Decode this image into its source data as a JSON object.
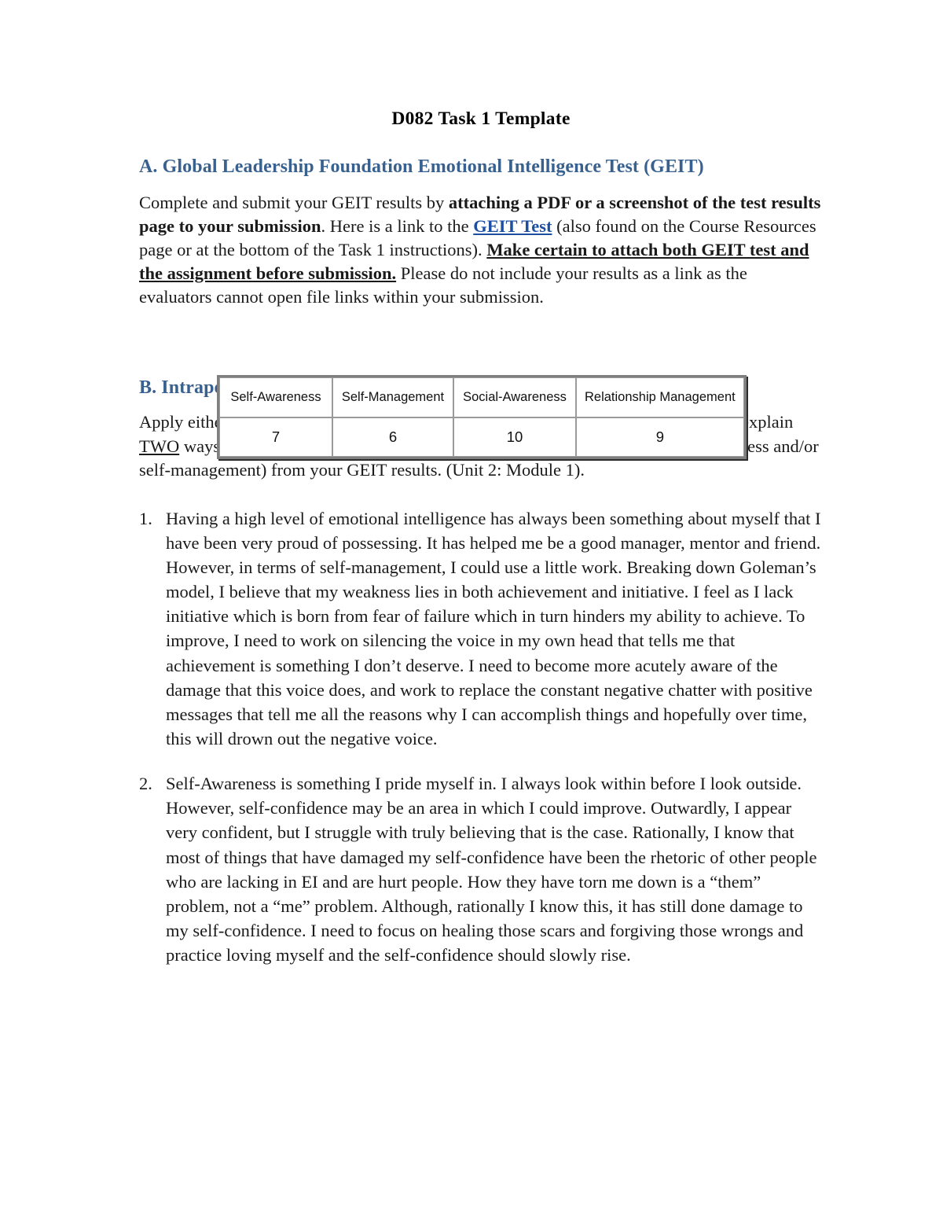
{
  "document": {
    "title": "D082 Task 1 Template",
    "accent_heading_color": "#39618f",
    "link_color": "#1d4fa0",
    "body_color": "#1a1a1a"
  },
  "section_a": {
    "heading": "A. Global Leadership Foundation Emotional Intelligence Test (GEIT)",
    "paragraph": {
      "part1": "Complete and submit your GEIT results by ",
      "bold1": "attaching a PDF or a screenshot of the test results page to your submission",
      "part2": ". Here is a link to the ",
      "link": "GEIT Test",
      "part3": " (also found on the Course Resources page or at the bottom of the Task 1 instructions). ",
      "bold_underline": "Make certain to attach both GEIT test and the assignment before submission.",
      "part4": " Please do not include your results as a link as the evaluators cannot open file links within your submission."
    }
  },
  "geit_table": {
    "headers": [
      "Self-Awareness",
      "Self-Management",
      "Social-Awareness",
      "Relationship Management"
    ],
    "values": [
      "7",
      "6",
      "10",
      "9"
    ]
  },
  "section_b": {
    "heading": "B. Intrapersonal Improvement",
    "paragraph": {
      "part1": "Apply either the research of Peter Salovey and John D. Mayer or Daniel Goleman to explain ",
      "underline": "TWO",
      "part2": " ways that you can improve your intrapersonal areas of opportunity (self-awareness and/or self-management) from your GEIT results. (Unit 2: Module 1)."
    },
    "answers": [
      {
        "marker": "1.",
        "text": "Having a high level of emotional intelligence has always been something about myself that I have been very proud of possessing. It has helped me be a good manager, mentor and friend. However, in terms of self-management, I could use a little work. Breaking down Goleman’s model, I believe that my weakness lies in both achievement and initiative. I feel as I lack initiative which is born from fear of failure which in turn hinders my ability to achieve. To improve, I need to work on silencing the voice in my own head that tells me that achievement is something I don’t deserve. I need to become more acutely aware of the damage that this voice does, and work to replace the constant negative chatter with positive messages that tell me all the reasons why I can accomplish things and hopefully over time, this will drown out the negative voice."
      },
      {
        "marker": "2.",
        "text": "Self-Awareness is something I pride myself in. I always look within before I look outside. However, self-confidence may be an area in which I could improve. Outwardly, I appear very confident, but I struggle with truly believing that is the case. Rationally, I know that most of things that have damaged my self-confidence have been the rhetoric of other people who are lacking in EI and are hurt people. How they have torn me down is a “them” problem, not a “me” problem. Although, rationally I know this, it has still done damage to my self-confidence. I need to focus on healing those scars and forgiving those wrongs and practice loving myself and the self-confidence should slowly rise."
      }
    ]
  }
}
